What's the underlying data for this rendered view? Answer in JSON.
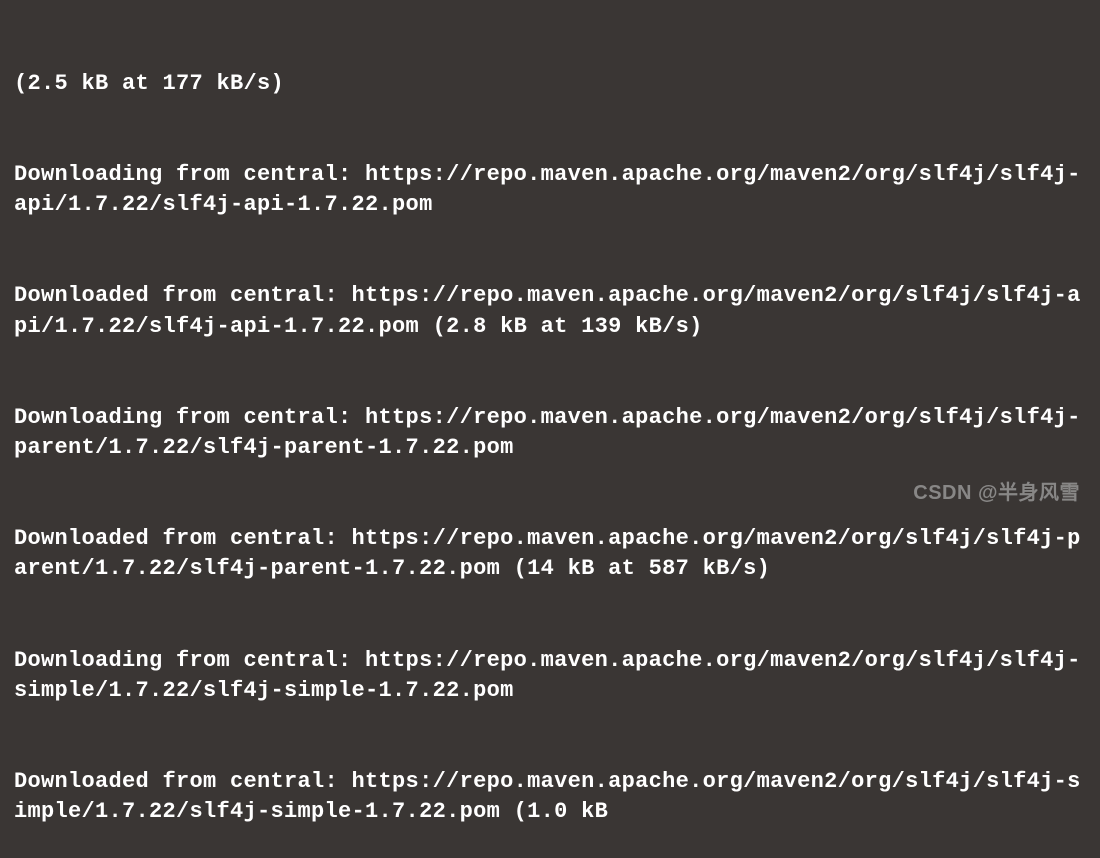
{
  "terminal": {
    "lines": [
      "(2.5 kB at 177 kB/s)",
      "Downloading from central: https://repo.maven.apache.org/maven2/org/slf4j/slf4j-api/1.7.22/slf4j-api-1.7.22.pom",
      "Downloaded from central: https://repo.maven.apache.org/maven2/org/slf4j/slf4j-api/1.7.22/slf4j-api-1.7.22.pom (2.8 kB at 139 kB/s)",
      "Downloading from central: https://repo.maven.apache.org/maven2/org/slf4j/slf4j-parent/1.7.22/slf4j-parent-1.7.22.pom",
      "Downloaded from central: https://repo.maven.apache.org/maven2/org/slf4j/slf4j-parent/1.7.22/slf4j-parent-1.7.22.pom (14 kB at 587 kB/s)",
      "Downloading from central: https://repo.maven.apache.org/maven2/org/slf4j/slf4j-simple/1.7.22/slf4j-simple-1.7.22.pom",
      "Downloaded from central: https://repo.maven.apache.org/maven2/org/slf4j/slf4j-simple/1.7.22/slf4j-simple-1.7.22.pom (1.0 kB"
    ]
  },
  "watermark": {
    "text": "CSDN @半身风雪"
  }
}
